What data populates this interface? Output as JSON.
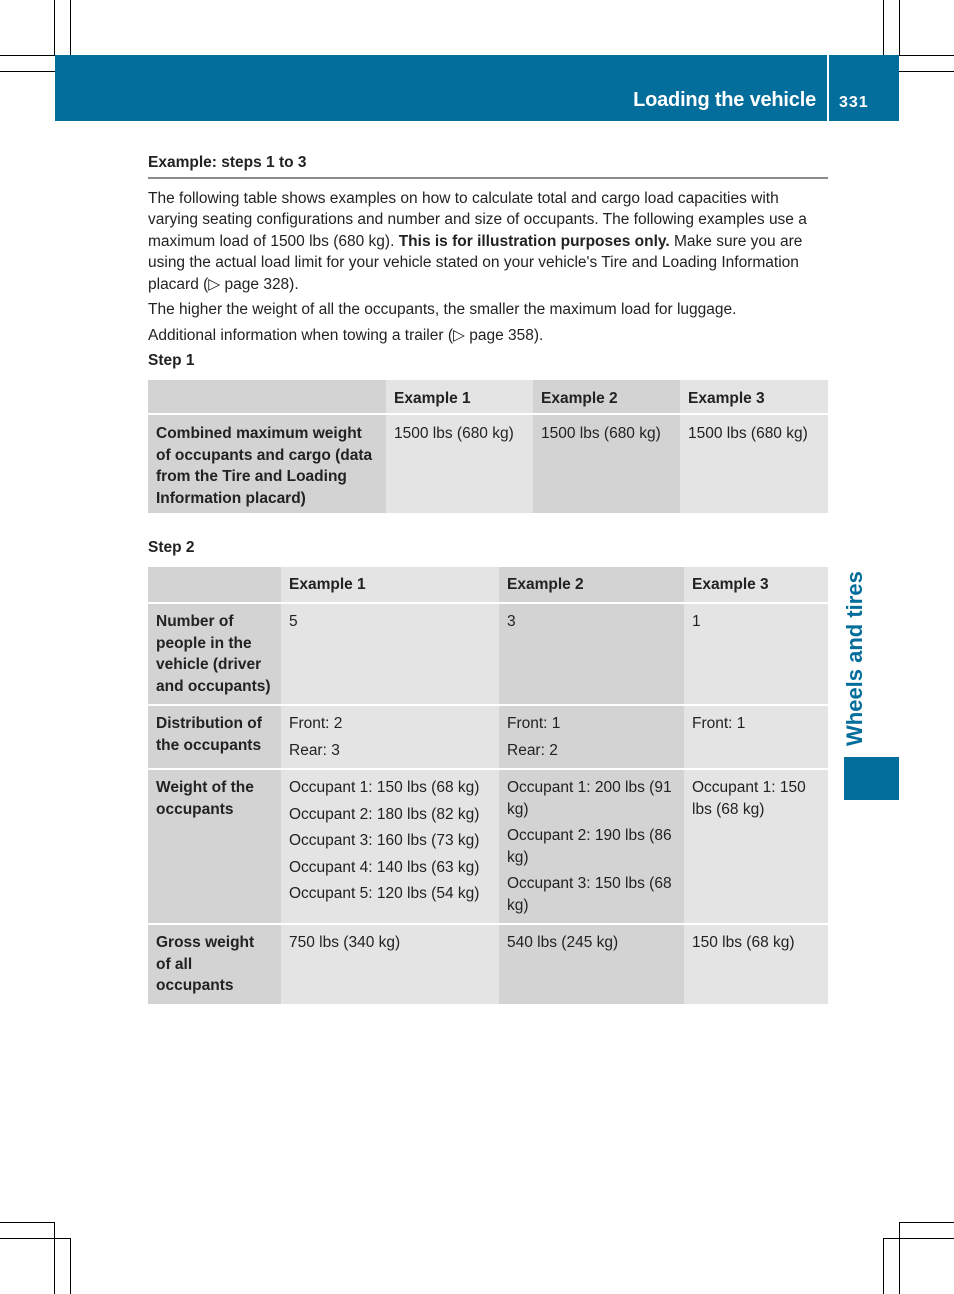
{
  "header": {
    "section_title": "Loading the vehicle",
    "page_number": "331"
  },
  "side_tab": {
    "label": "Wheels and tires"
  },
  "colors": {
    "brand_blue": "#036d9c",
    "table_dark": "#d3d3d3",
    "table_light": "#e4e4e4"
  },
  "content": {
    "title": "Example: steps 1 to 3",
    "para1_part1": "The following table shows examples on how to calculate total and cargo load capacities with varying seating configurations and number and size of occupants. The following examples use a maximum load of 1500 lbs (680 kg). ",
    "para1_bold": "This is for illustration purposes only.",
    "para1_part2": " Make sure you are using the actual load limit for your vehicle stated on your vehicle's Tire and Loading Information placard (▷ page 328).",
    "para2": "The higher the weight of all the occupants, the smaller the maximum load for luggage.",
    "para3": "Additional information when towing a trailer (▷ page 358).",
    "step1_label": "Step 1",
    "step2_label": "Step 2"
  },
  "step1_table": {
    "headers": [
      "",
      "Example 1",
      "Example 2",
      "Example 3"
    ],
    "rows": [
      {
        "label": "Combined maximum weight of occupants and cargo (data from the Tire and Loading Information placard)",
        "values": [
          "1500 lbs (680 kg)",
          "1500 lbs (680 kg)",
          "1500 lbs (680 kg)"
        ]
      }
    ]
  },
  "step2_table": {
    "headers": [
      "",
      "Example 1",
      "Example 2",
      "Example 3"
    ],
    "rows": [
      {
        "label": "Number of people in the vehicle (driver and occupants)",
        "values": [
          [
            "5"
          ],
          [
            "3"
          ],
          [
            "1"
          ]
        ]
      },
      {
        "label": "Distribution of the occupants",
        "values": [
          [
            "Front: 2",
            "Rear: 3"
          ],
          [
            "Front: 1",
            "Rear: 2"
          ],
          [
            "Front: 1"
          ]
        ]
      },
      {
        "label": "Weight of the occupants",
        "values": [
          [
            "Occupant 1: 150 lbs (68 kg)",
            "Occupant 2: 180 lbs (82 kg)",
            "Occupant 3: 160 lbs (73 kg)",
            "Occupant 4: 140 lbs (63 kg)",
            "Occupant 5: 120 lbs (54 kg)"
          ],
          [
            "Occupant 1: 200 lbs (91 kg)",
            "Occupant 2: 190 lbs (86 kg)",
            "Occupant 3: 150 lbs (68 kg)"
          ],
          [
            "Occupant 1: 150 lbs (68 kg)"
          ]
        ]
      },
      {
        "label": "Gross weight of all occupants",
        "values": [
          [
            "750 lbs (340 kg)"
          ],
          [
            "540 lbs (245 kg)"
          ],
          [
            "150 lbs (68 kg)"
          ]
        ]
      }
    ]
  }
}
